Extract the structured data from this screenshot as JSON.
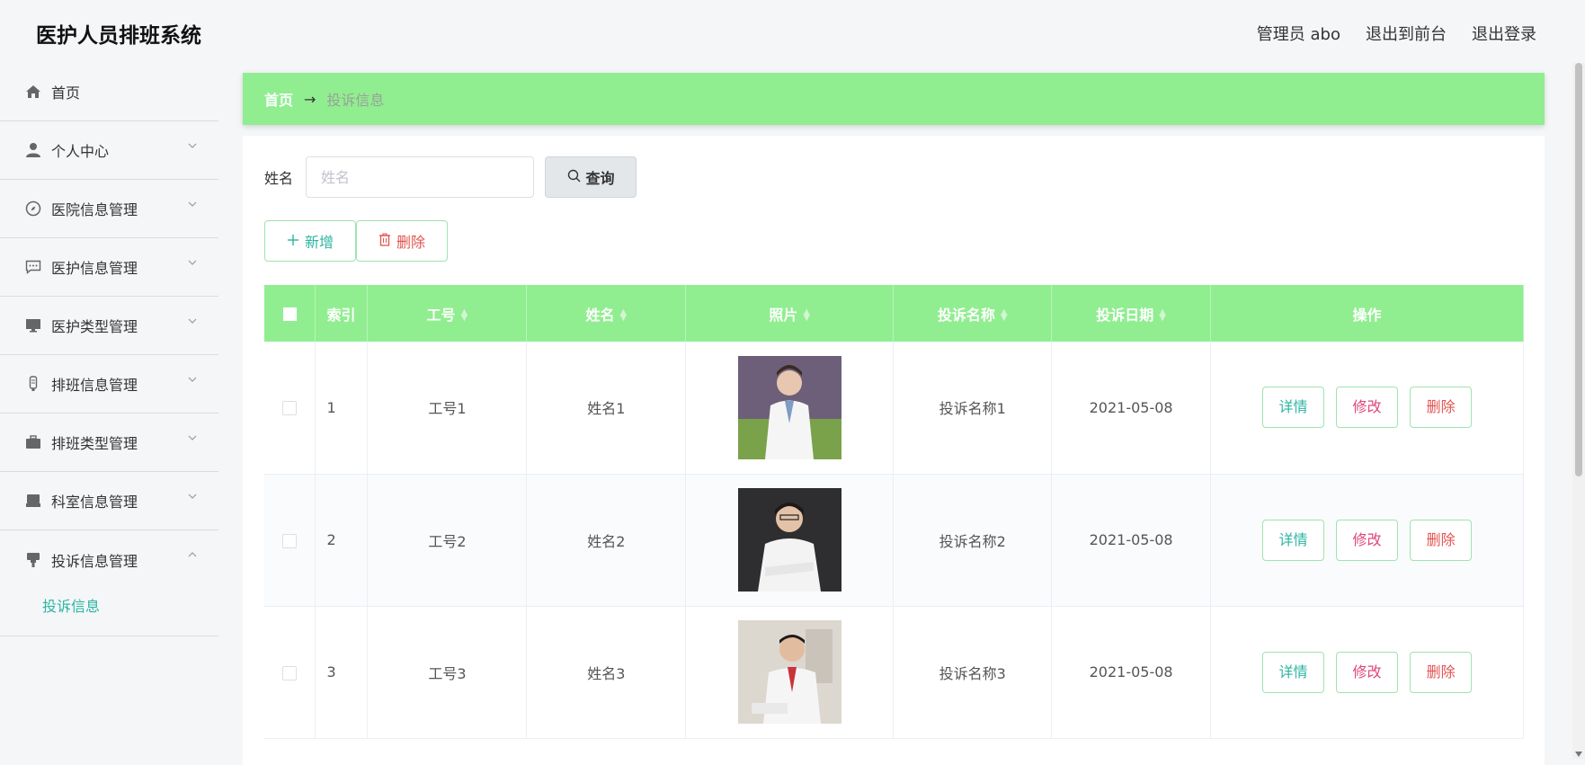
{
  "app": {
    "title": "医护人员排班系统"
  },
  "header": {
    "admin_label": "管理员 abo",
    "to_front_label": "退出到前台",
    "logout_label": "退出登录"
  },
  "sidebar": {
    "items": [
      {
        "label": "首页",
        "icon": "home-icon"
      },
      {
        "label": "个人中心",
        "icon": "user-icon"
      },
      {
        "label": "医院信息管理",
        "icon": "compass-icon"
      },
      {
        "label": "医护信息管理",
        "icon": "message-icon"
      },
      {
        "label": "医护类型管理",
        "icon": "monitor-icon"
      },
      {
        "label": "排班信息管理",
        "icon": "mic-icon"
      },
      {
        "label": "排班类型管理",
        "icon": "briefcase-icon"
      },
      {
        "label": "科室信息管理",
        "icon": "printer-icon"
      },
      {
        "label": "投诉信息管理",
        "icon": "stamp-icon"
      }
    ],
    "sub_item": "投诉信息"
  },
  "breadcrumb": {
    "home": "首页",
    "current": "投诉信息"
  },
  "search": {
    "label": "姓名",
    "placeholder": "姓名",
    "button_label": "查询"
  },
  "actions": {
    "add_label": "新增",
    "delete_label": "删除"
  },
  "table": {
    "headers": {
      "index": "索引",
      "job_no": "工号",
      "name": "姓名",
      "photo": "照片",
      "complaint_name": "投诉名称",
      "complaint_date": "投诉日期",
      "ops": "操作"
    },
    "rows": [
      {
        "index": "1",
        "job_no": "工号1",
        "name": "姓名1",
        "complaint_name": "投诉名称1",
        "complaint_date": "2021-05-08"
      },
      {
        "index": "2",
        "job_no": "工号2",
        "name": "姓名2",
        "complaint_name": "投诉名称2",
        "complaint_date": "2021-05-08"
      },
      {
        "index": "3",
        "job_no": "工号3",
        "name": "姓名3",
        "complaint_name": "投诉名称3",
        "complaint_date": "2021-05-08"
      }
    ],
    "row_actions": {
      "detail": "详情",
      "edit": "修改",
      "delete": "删除"
    }
  },
  "colors": {
    "accent": "#90ee90",
    "teal": "#2bb5a0",
    "pink": "#e0457b",
    "red": "#e3534f"
  }
}
